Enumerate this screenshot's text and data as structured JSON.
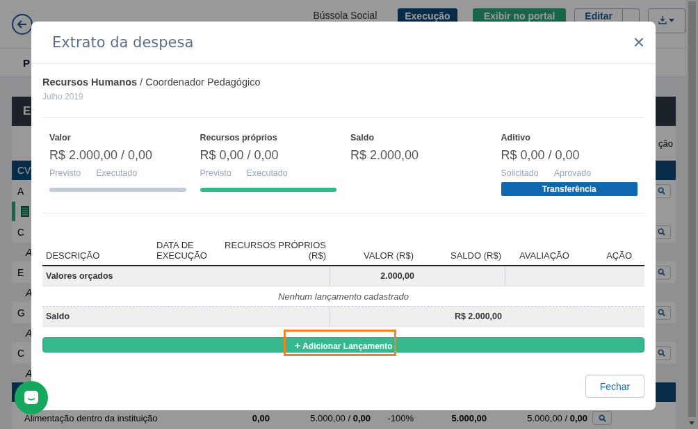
{
  "page": {
    "header": {
      "project_tag": "Bússola Social",
      "status_badge": "Execução",
      "portal_button": "Exibir no portal",
      "edit_button": "Editar"
    },
    "tabs": [
      {
        "label": "P",
        "selected": true
      }
    ],
    "panel": {
      "title": "E",
      "column_header": "ção",
      "rows": [
        {
          "kind": "dark",
          "text": "CV",
          "search": false
        },
        {
          "kind": "item",
          "text": "A",
          "search": true
        },
        {
          "kind": "green",
          "text": "",
          "search": false
        },
        {
          "kind": "item",
          "text": "C",
          "search": true
        },
        {
          "kind": "sub",
          "text": "A",
          "search": false
        },
        {
          "kind": "item",
          "text": "E",
          "search": true
        },
        {
          "kind": "sub",
          "text": "A",
          "search": false
        },
        {
          "kind": "item",
          "text": "G",
          "search": true
        },
        {
          "kind": "sub",
          "text": "A",
          "search": false
        },
        {
          "kind": "item",
          "text": "C",
          "search": true
        },
        {
          "kind": "sub",
          "text": "A",
          "search": false
        },
        {
          "kind": "dark",
          "text": "",
          "search": false
        }
      ],
      "last_row": {
        "text": "Alimentação dentro da instituição",
        "cells": [
          {
            "text": "0,00",
            "strong": true
          },
          {
            "text": "5.000,00 / **0,00**",
            "strong": false
          },
          {
            "text": "-100%",
            "strong": false
          },
          {
            "text": "5.000,00",
            "strong": true
          },
          {
            "text": "5.000,00 / **0,00**",
            "strong": false
          }
        ]
      }
    }
  },
  "modal": {
    "title": "Extrato da despesa",
    "close": "×",
    "heading": "**Recursos Humanos** / Coordenador Pedagógico",
    "period": "Julho 2019",
    "stats": [
      {
        "kind": "bar",
        "label": "Valor",
        "value": "R$ 2.000,00 / 0,00",
        "sublabels": [
          "Previsto",
          "Executado"
        ],
        "level": 0
      },
      {
        "kind": "bar",
        "label": "Recursos próprios",
        "value": "R$ 0,00 / 0,00",
        "sublabels": [
          "Previsto",
          "Executado"
        ],
        "level": 1
      },
      {
        "kind": "plain",
        "label": "Saldo",
        "value": "R$ 2.000,00"
      },
      {
        "kind": "button",
        "label": "Aditivo",
        "value": "R$ 0,00 / 0,00",
        "sublabels": [
          "Solicitado",
          "Aprovado"
        ],
        "button": "Transferência"
      }
    ],
    "table": {
      "columns": [
        "DESCRIÇÃO",
        "DATA DE EXECUÇÃO",
        "RECURSOS PRÓPRIOS (R$)",
        "VALOR (R$)",
        "SALDO (R$)",
        "AVALIAÇÃO",
        "AÇÃO"
      ],
      "rows": [
        {
          "kind": "budget",
          "label": "Valores orçados",
          "value": "2.000,00"
        },
        {
          "kind": "empty",
          "text": "Nenhum lançamento cadastrado"
        },
        {
          "kind": "balance",
          "label": "Saldo",
          "value": "R$ 2.000,00"
        }
      ]
    },
    "add_button": {
      "icon": "+",
      "label": "Adicionar Lançamento",
      "highlighted": true
    },
    "footer_button": "Fechar"
  }
}
